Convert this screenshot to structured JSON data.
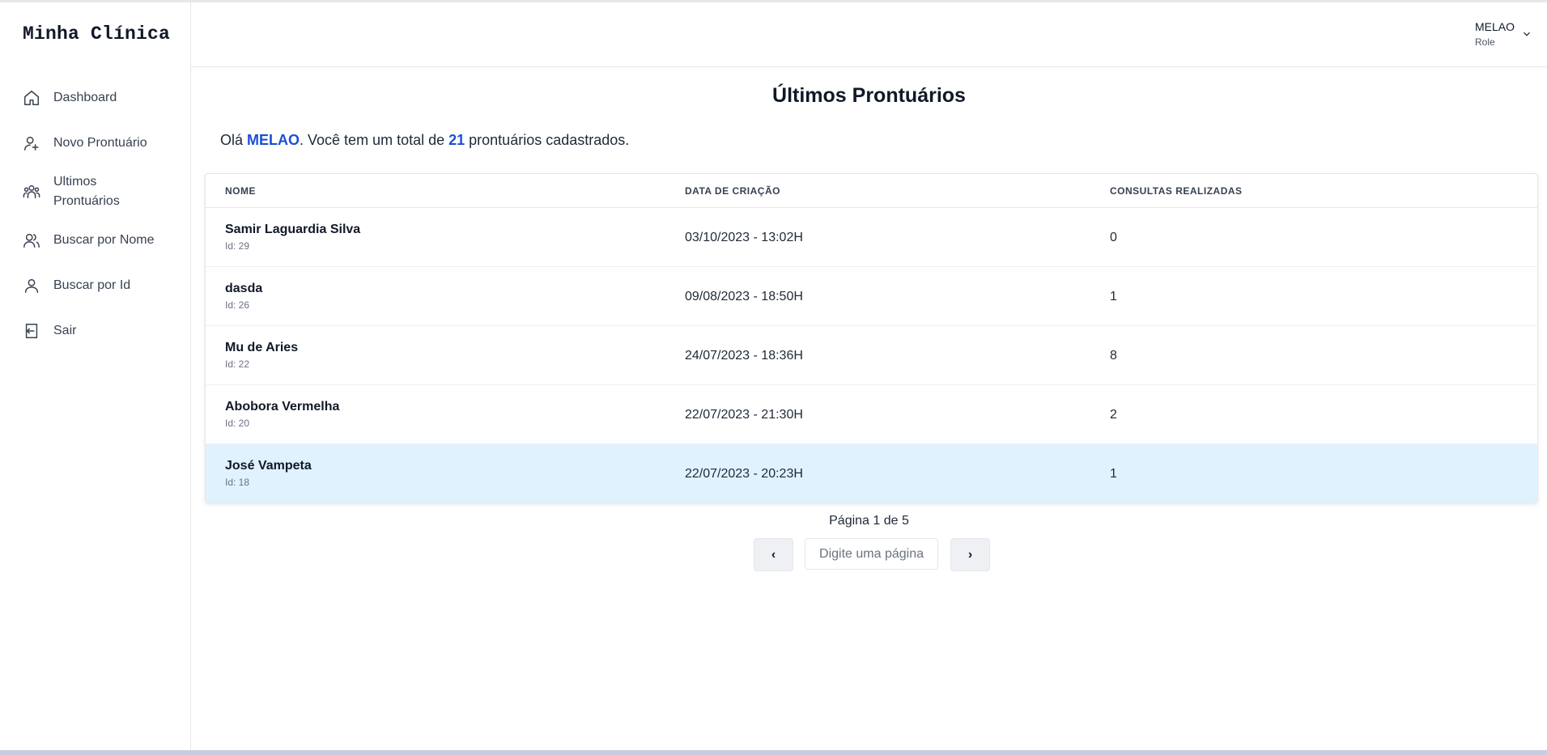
{
  "app": {
    "brand": "Minha Clínica"
  },
  "sidebar": {
    "items": [
      {
        "label": "Dashboard",
        "icon": "home-icon"
      },
      {
        "label": "Novo Prontuário",
        "icon": "user-plus-icon"
      },
      {
        "label": "Ultimos Prontuários",
        "icon": "users-group-icon"
      },
      {
        "label": "Buscar por Nome",
        "icon": "users-icon"
      },
      {
        "label": "Buscar por Id",
        "icon": "user-icon"
      },
      {
        "label": "Sair",
        "icon": "logout-icon"
      }
    ]
  },
  "header": {
    "user_name": "MELAO",
    "user_role": "Role"
  },
  "main": {
    "title": "Últimos Prontuários",
    "greeting_prefix": "Olá ",
    "greeting_user": "MELAO",
    "greeting_middle": ". Você tem um total de ",
    "greeting_total": "21",
    "greeting_suffix": " prontuários cadastrados."
  },
  "table": {
    "columns": [
      "NOME",
      "DATA DE CRIAÇÃO",
      "CONSULTAS REALIZADAS"
    ],
    "rows": [
      {
        "name": "Samir Laguardia Silva",
        "id": "Id: 29",
        "date": "03/10/2023 - 13:02H",
        "consultas": "0"
      },
      {
        "name": "dasda",
        "id": "Id: 26",
        "date": "09/08/2023 - 18:50H",
        "consultas": "1"
      },
      {
        "name": "Mu de Aries",
        "id": "Id: 22",
        "date": "24/07/2023 - 18:36H",
        "consultas": "8"
      },
      {
        "name": "Abobora Vermelha",
        "id": "Id: 20",
        "date": "22/07/2023 - 21:30H",
        "consultas": "2"
      },
      {
        "name": "José Vampeta",
        "id": "Id: 18",
        "date": "22/07/2023 - 20:23H",
        "consultas": "1"
      }
    ],
    "selected_index": 4
  },
  "pagination": {
    "info": "Página 1 de 5",
    "prev_label": "‹",
    "next_label": "›",
    "input_placeholder": "Digite uma página"
  },
  "colors": {
    "accent": "#1d4ed8",
    "selected_row": "#e0f2fe"
  }
}
